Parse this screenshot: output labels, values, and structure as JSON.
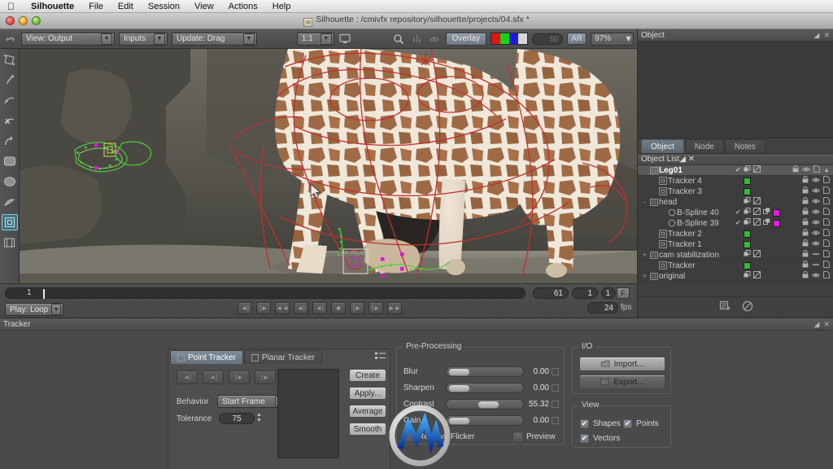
{
  "menubar": {
    "apple_icon": "apple-icon",
    "items": [
      {
        "label": "Silhouette",
        "bold": true
      },
      {
        "label": "File"
      },
      {
        "label": "Edit"
      },
      {
        "label": "Session"
      },
      {
        "label": "View"
      },
      {
        "label": "Actions"
      },
      {
        "label": "Help"
      }
    ]
  },
  "window": {
    "title": "Silhouette : /cmivfx repository/silhouette/projects/04.sfx *",
    "badge": "sfx",
    "controls": [
      "close",
      "minimize",
      "zoom"
    ]
  },
  "viewer_toolbar": {
    "link_icon": "link-icon",
    "view_combo": "View: Output",
    "inputs_combo": "Inputs",
    "update_combo": "Update: Drag",
    "ratio_combo": "1:1",
    "monitor_icon": "monitor-icon",
    "zoom_icon": "magnifier-icon",
    "histogram_icon": "histogram-icon",
    "mask_icon": "mask-icon",
    "overlay_button": "Overlay",
    "channels_icon": "rgb-channels-icon",
    "opacity_value": "50",
    "ar_button": "AR",
    "zoom_level": "97%"
  },
  "toolstrip": {
    "tools": [
      {
        "name": "transform-tool",
        "glyph": "◳"
      },
      {
        "name": "bezier-pen-tool",
        "glyph": "✎"
      },
      {
        "name": "add-point-tool",
        "glyph": "⌁"
      },
      {
        "name": "remove-point-tool",
        "glyph": "✗"
      },
      {
        "name": "curve-tool",
        "glyph": "↷"
      },
      {
        "name": "rectangle-tool",
        "glyph": "▭"
      },
      {
        "name": "ellipse-tool",
        "glyph": "⬭"
      },
      {
        "name": "freehand-tool",
        "glyph": "✐"
      },
      {
        "name": "tracker-tool",
        "glyph": "⊡",
        "selected": true
      },
      {
        "name": "filmstrip-tool",
        "glyph": "▤"
      }
    ]
  },
  "timeline": {
    "current_frame": "1",
    "end_frame": "61",
    "in_point": "1",
    "out_point": "1",
    "f_button": "F",
    "play_mode": "Play: Loop",
    "fps_value": "24",
    "fps_label": "fps",
    "transport_buttons": [
      {
        "name": "set-in-point-button",
        "glyph": "◄|"
      },
      {
        "name": "set-out-point-button",
        "glyph": "|►"
      },
      {
        "name": "go-to-start-button",
        "glyph": "◄◄"
      },
      {
        "name": "previous-frame-button",
        "glyph": "◄|"
      },
      {
        "name": "play-reverse-button",
        "glyph": "◄|"
      },
      {
        "name": "stop-button",
        "glyph": "■"
      },
      {
        "name": "play-forward-button",
        "glyph": "|►"
      },
      {
        "name": "next-frame-button",
        "glyph": "|►"
      },
      {
        "name": "go-to-end-button",
        "glyph": "►►"
      }
    ]
  },
  "object_panel": {
    "header_title": "Object",
    "tabs": [
      {
        "label": "Object",
        "active": true
      },
      {
        "label": "Node",
        "active": false
      },
      {
        "label": "Notes",
        "active": false
      }
    ],
    "list_title": "Object List",
    "rows": [
      {
        "name": "Leg01",
        "indent": 1,
        "type_icon": "layer-icon",
        "selected": true,
        "expand": "",
        "check": true,
        "copy": true,
        "mask": true,
        "link": false,
        "color": null,
        "lock": true,
        "eye": "eye",
        "page": true,
        "caret": true
      },
      {
        "name": "Tracker 4",
        "indent": 2,
        "type_icon": "tracker-icon",
        "selected": false,
        "expand": "",
        "check": false,
        "copy": false,
        "mask": false,
        "link": false,
        "color": "#2fbd2f",
        "lock": true,
        "eye": "eye",
        "page": true,
        "caret": false
      },
      {
        "name": "Tracker 3",
        "indent": 2,
        "type_icon": "tracker-icon",
        "selected": false,
        "expand": "",
        "check": false,
        "copy": false,
        "mask": false,
        "link": false,
        "color": "#2fbd2f",
        "lock": true,
        "eye": "eye",
        "page": true,
        "caret": false
      },
      {
        "name": "head",
        "indent": 1,
        "type_icon": "layer-icon",
        "selected": false,
        "expand": "-",
        "check": false,
        "copy": true,
        "mask": true,
        "link": false,
        "color": null,
        "lock": true,
        "eye": "eye",
        "page": true,
        "caret": false
      },
      {
        "name": "B-Spline 40",
        "indent": 3,
        "type_icon": "spline-icon",
        "selected": false,
        "expand": "",
        "check": true,
        "copy": true,
        "mask": true,
        "link": true,
        "color": "#e01ee0",
        "lock": true,
        "eye": "eye",
        "page": true,
        "caret": false
      },
      {
        "name": "B-Spline 39",
        "indent": 3,
        "type_icon": "spline-icon",
        "selected": false,
        "expand": "",
        "check": true,
        "copy": true,
        "mask": true,
        "link": true,
        "color": "#e01ee0",
        "lock": true,
        "eye": "eye",
        "page": true,
        "caret": false
      },
      {
        "name": "Tracker 2",
        "indent": 2,
        "type_icon": "tracker-icon",
        "selected": false,
        "expand": "",
        "check": false,
        "copy": false,
        "mask": false,
        "link": false,
        "color": "#2fbd2f",
        "lock": true,
        "eye": "eye",
        "page": true,
        "caret": false
      },
      {
        "name": "Tracker 1",
        "indent": 2,
        "type_icon": "tracker-icon",
        "selected": false,
        "expand": "",
        "check": false,
        "copy": false,
        "mask": false,
        "link": false,
        "color": "#2fbd2f",
        "lock": true,
        "eye": "eye",
        "page": true,
        "caret": false
      },
      {
        "name": "cam stabilization",
        "indent": 1,
        "type_icon": "layer-icon",
        "selected": false,
        "expand": "+",
        "check": false,
        "copy": true,
        "mask": true,
        "link": false,
        "color": null,
        "lock": true,
        "eye": "dash",
        "page": true,
        "caret": false
      },
      {
        "name": "Tracker",
        "indent": 2,
        "type_icon": "tracker-icon",
        "selected": false,
        "expand": "",
        "check": false,
        "copy": false,
        "mask": false,
        "link": false,
        "color": "#2fbd2f",
        "lock": true,
        "eye": "dash",
        "page": true,
        "caret": false
      },
      {
        "name": "original",
        "indent": 1,
        "type_icon": "layer-icon",
        "selected": false,
        "expand": "+",
        "check": false,
        "copy": true,
        "mask": true,
        "link": false,
        "color": null,
        "lock": true,
        "eye": "eye",
        "page": true,
        "caret": false
      }
    ],
    "footer_icons": [
      "new-object-icon",
      "disable-icon"
    ]
  },
  "tracker_panel": {
    "header_title": "Tracker",
    "tabs": [
      {
        "label": "Point Tracker",
        "active": true
      },
      {
        "label": "Planar Tracker",
        "active": false
      }
    ],
    "list_view_icon": "list-view-icon",
    "step_buttons": [
      {
        "name": "track-backward-all-button",
        "glyph": "◄|"
      },
      {
        "name": "track-backward-button",
        "glyph": "◄|"
      },
      {
        "name": "track-forward-button",
        "glyph": "|►"
      },
      {
        "name": "track-forward-all-button",
        "glyph": "|►"
      }
    ],
    "behavior_label": "Behavior",
    "behavior_value": "Start Frame",
    "tolerance_label": "Tolerance",
    "tolerance_value": "75",
    "action_buttons": [
      "Create",
      "Apply...",
      "Average",
      "Smooth"
    ],
    "preprocessing": {
      "title": "Pre-Processing",
      "sliders": [
        {
          "label": "Blur",
          "value": "0.00",
          "pos": 0
        },
        {
          "label": "Sharpen",
          "value": "0.00",
          "pos": 0
        },
        {
          "label": "Contrast",
          "value": "55.32",
          "pos": 55
        },
        {
          "label": "Gain",
          "value": "0.00",
          "pos": 0
        }
      ],
      "deflicker_label": "Remove Flicker",
      "deflicker_checked": false,
      "preview_label": "Preview",
      "preview_checked": false
    },
    "io": {
      "title": "I/O",
      "import_label": "Import...",
      "export_label": "Export..."
    },
    "view": {
      "title": "View",
      "options": [
        {
          "label": "Shapes",
          "checked": true
        },
        {
          "label": "Points",
          "checked": true
        },
        {
          "label": "Vectors",
          "checked": true
        }
      ]
    }
  },
  "colors": {
    "accent": "#6f7d88",
    "tracker_green": "#2fbd2f",
    "spline_magenta": "#e01ee0",
    "panel_bg": "#4a4a4a",
    "shape_red": "#c0302e",
    "selection_green": "#4ecb3c"
  }
}
